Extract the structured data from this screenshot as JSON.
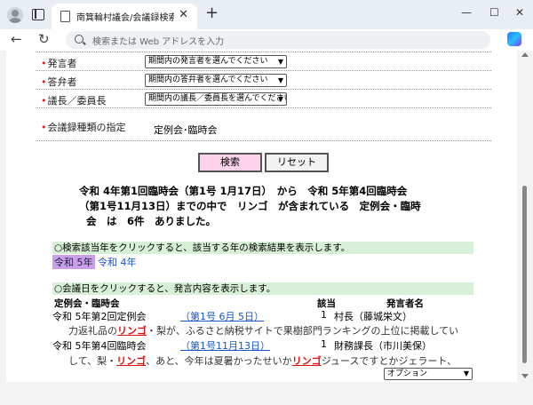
{
  "browser": {
    "tab_title": "南箕輪村議会/会議録検索システム",
    "tab_close": "✕",
    "new_tab": "+",
    "minimize": "—",
    "maximize": "☐",
    "close": "✕",
    "back": "←",
    "reload": "↻",
    "address_placeholder": "検索または Web アドレスを入力"
  },
  "form": {
    "rows": [
      {
        "label": "発言者",
        "select": "期間内の発言者を選んでください"
      },
      {
        "label": "答弁者",
        "select": "期間内の答弁者を選んでください"
      },
      {
        "label": "議長／委員長",
        "select": "期間内の議長／委員長を選んでください"
      }
    ],
    "kind_label": "会議録種類の指定",
    "kind_value": "定例会･臨時会",
    "search_button": "検索",
    "reset_button": "リセット"
  },
  "result": {
    "line1": "令和 4年第1回臨時会（第1号 1月17日）　から　令和 5年第4回臨時会",
    "line2": "（第1号11月13日）までの中で　リンゴ　が含まれている　定例会・臨時",
    "line3": "会　は　6件　ありました。"
  },
  "year_section": {
    "instruction": "○検索該当年をクリックすると、該当する年の検索結果を表示します。",
    "selected_year": "令和 5年",
    "other_year": "令和 4年"
  },
  "meetings_section": {
    "instruction": "○会議日をクリックすると、発言内容を表示します。",
    "col_meeting": "定例会・臨時会",
    "col_count": "該当",
    "col_speaker": "発言者名",
    "meetings": [
      {
        "name": "令和 5年第2回定例会",
        "date_link": "（第1号 6月 5日）",
        "count": "1",
        "speaker": "村長（藤城栄文）",
        "excerpt_pre": "力返礼品の",
        "excerpt_hl1": "リンゴ",
        "excerpt_mid": "・梨が、ふるさと納税サイトで果樹部門ランキングの上位に掲載してい",
        "excerpt_hl2": "",
        "excerpt_post": ""
      },
      {
        "name": "令和 5年第4回臨時会",
        "date_link": "（第1号11月13日）",
        "count": "1",
        "speaker": "財務課長（市川美保）",
        "excerpt_pre": "して、梨・",
        "excerpt_hl1": "リンゴ",
        "excerpt_mid": "、あと、今年は夏暑かったせいか",
        "excerpt_hl2": "リンゴ",
        "excerpt_post": "ジュースですとかジェラート、"
      }
    ],
    "option_select": "オプション"
  }
}
